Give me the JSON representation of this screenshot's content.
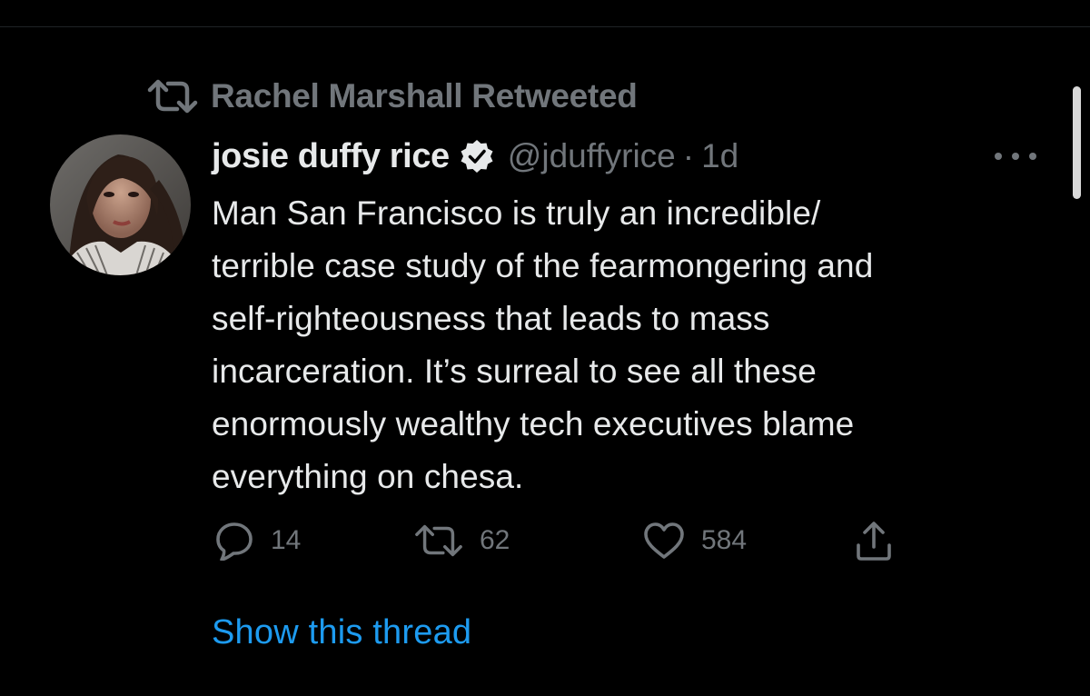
{
  "colors": {
    "background": "#000000",
    "primary_text": "#e7e9ea",
    "secondary_text": "#71767b",
    "link": "#1d9bf0"
  },
  "social_context": {
    "icon": "retweet-icon",
    "text": "Rachel Marshall Retweeted"
  },
  "tweet": {
    "author": {
      "avatar_icon": "avatar",
      "name": "josie duffy rice",
      "verified_icon": "verified-badge-icon",
      "handle": "@jduffyrice",
      "separator": "·",
      "timestamp": "1d"
    },
    "more_icon": "more-dots-icon",
    "text_lines": [
      "Man San Francisco is truly an incredible/",
      "terrible case study of the fearmongering and",
      "self-righteousness that leads to mass",
      "incarceration. It’s surreal to see all these",
      "enormously wealthy tech executives blame",
      "everything on chesa."
    ],
    "actions": {
      "reply": {
        "icon": "reply-icon",
        "count": "14"
      },
      "retweet": {
        "icon": "retweet-icon",
        "count": "62"
      },
      "like": {
        "icon": "heart-icon",
        "count": "584"
      },
      "share": {
        "icon": "share-icon"
      }
    },
    "show_thread_label": "Show this thread"
  }
}
